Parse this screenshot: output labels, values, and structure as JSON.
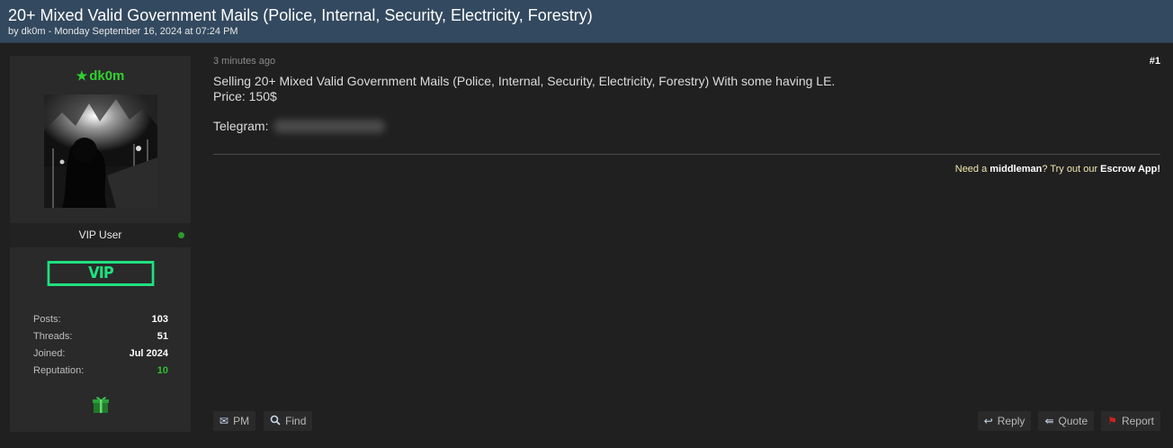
{
  "thread": {
    "title": "20+ Mixed Valid Government Mails (Police, Internal, Security, Electricity, Forestry)",
    "meta": "by dk0m - Monday September 16, 2024 at 07:24 PM"
  },
  "user": {
    "star_icon": "star-icon",
    "username": "dk0m",
    "usergroup": "VIP User",
    "badge": "VIP",
    "stats": [
      {
        "label": "Posts:",
        "value": "103"
      },
      {
        "label": "Threads:",
        "value": "51"
      },
      {
        "label": "Joined:",
        "value": "Jul 2024"
      },
      {
        "label": "Reputation:",
        "value": "10"
      }
    ],
    "award_icon": "gift-icon"
  },
  "post": {
    "date": "3 minutes ago",
    "number": "#1",
    "lines": [
      "Selling 20+ Mixed Valid Government Mails (Police, Internal, Security, Electricity, Forestry) With some having LE.",
      "Price: 150$"
    ],
    "telegram_label": "Telegram:",
    "signature": {
      "prefix": "Need a ",
      "middleman": "middleman",
      "middle": "? Try out our ",
      "escrow": "Escrow App!"
    }
  },
  "actions": {
    "left": [
      {
        "label": "PM",
        "icon": "envelope-icon"
      },
      {
        "label": "Find",
        "icon": "search-icon"
      }
    ],
    "right": [
      {
        "label": "Reply",
        "icon": "reply-icon"
      },
      {
        "label": "Quote",
        "icon": "quote-icon"
      },
      {
        "label": "Report",
        "icon": "flag-icon"
      }
    ]
  },
  "colors": {
    "header_bg": "#33495f",
    "username": "#30d230",
    "vip_badge": "#1fe07f",
    "reputation": "#2fbf2f"
  }
}
